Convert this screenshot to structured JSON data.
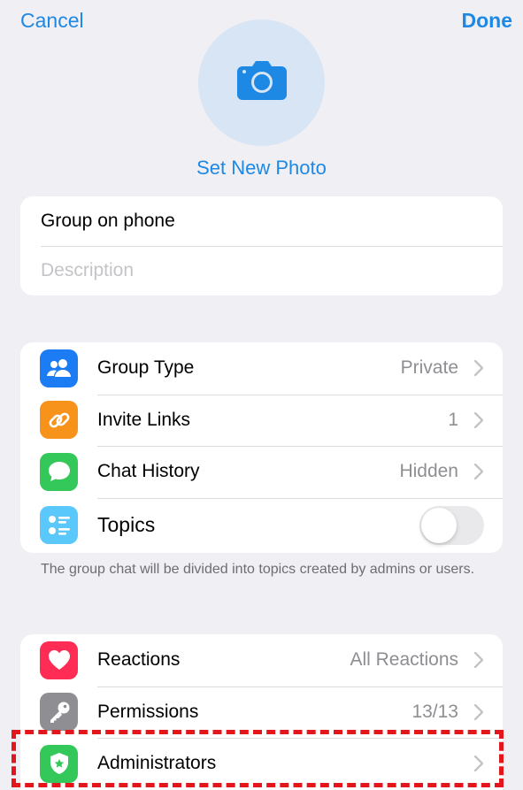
{
  "nav": {
    "cancel_label": "Cancel",
    "done_label": "Done"
  },
  "photo": {
    "set_label": "Set New Photo"
  },
  "info": {
    "group_name": "Group on phone",
    "description_placeholder": "Description"
  },
  "settings": {
    "items": [
      {
        "label": "Group Type",
        "value": "Private",
        "icon": "people-icon",
        "color": "#1c7cf4"
      },
      {
        "label": "Invite Links",
        "value": "1",
        "icon": "link-icon",
        "color": "#f7931a"
      },
      {
        "label": "Chat History",
        "value": "Hidden",
        "icon": "chat-bubble-icon",
        "color": "#34c759"
      },
      {
        "label": "Topics",
        "value": "",
        "icon": "list-icon",
        "color": "#5ac8fa"
      }
    ],
    "topics_enabled": false,
    "footnote": "The group chat will be divided into topics created by admins or users."
  },
  "admin": {
    "items": [
      {
        "label": "Reactions",
        "value": "All Reactions",
        "icon": "heart-icon",
        "color": "#ff2d55"
      },
      {
        "label": "Permissions",
        "value": "13/13",
        "icon": "key-icon",
        "color": "#8e8e93"
      },
      {
        "label": "Administrators",
        "value": "",
        "icon": "admin-badge-icon",
        "color": "#34c759"
      }
    ]
  },
  "colors": {
    "accent": "#1e88e5",
    "background": "#efeff4",
    "highlight": "#e3161c"
  }
}
